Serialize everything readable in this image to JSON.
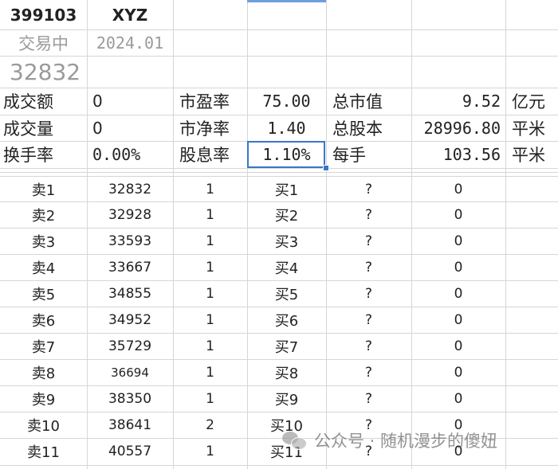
{
  "header": {
    "code": "399103",
    "name": "XYZ",
    "status": "交易中",
    "date": "2024.01",
    "price": "32832"
  },
  "stats": [
    {
      "label": "成交额",
      "value": "0",
      "label2": "市盈率",
      "value2": "75.00",
      "label3": "总市值",
      "value3": "9.52",
      "unit": "亿元"
    },
    {
      "label": "成交量",
      "value": "0",
      "label2": "市净率",
      "value2": "1.40",
      "label3": "总股本",
      "value3": "28996.80",
      "unit": "平米"
    },
    {
      "label": "换手率",
      "value": "0.00%",
      "label2": "股息率",
      "value2": "1.10%",
      "label3": "每手",
      "value3": "103.56",
      "unit": "平米"
    }
  ],
  "orderbook": [
    {
      "sell": "卖1",
      "price": "32832",
      "qty": "1",
      "buy": "买1",
      "bprice": "?",
      "bqty": "0"
    },
    {
      "sell": "卖2",
      "price": "32928",
      "qty": "1",
      "buy": "买2",
      "bprice": "?",
      "bqty": "0"
    },
    {
      "sell": "卖3",
      "price": "33593",
      "qty": "1",
      "buy": "买3",
      "bprice": "?",
      "bqty": "0"
    },
    {
      "sell": "卖4",
      "price": "33667",
      "qty": "1",
      "buy": "买4",
      "bprice": "?",
      "bqty": "0"
    },
    {
      "sell": "卖5",
      "price": "34855",
      "qty": "1",
      "buy": "买5",
      "bprice": "?",
      "bqty": "0"
    },
    {
      "sell": "卖6",
      "price": "34952",
      "qty": "1",
      "buy": "买6",
      "bprice": "?",
      "bqty": "0"
    },
    {
      "sell": "卖7",
      "price": "35729",
      "qty": "1",
      "buy": "买7",
      "bprice": "?",
      "bqty": "0"
    },
    {
      "sell": "卖8",
      "price": "36694",
      "qty": "1",
      "buy": "买8",
      "bprice": "?",
      "bqty": "0"
    },
    {
      "sell": "卖9",
      "price": "38350",
      "qty": "1",
      "buy": "买9",
      "bprice": "?",
      "bqty": "0"
    },
    {
      "sell": "卖10",
      "price": "38641",
      "qty": "2",
      "buy": "买10",
      "bprice": "?",
      "bqty": "0"
    },
    {
      "sell": "卖11",
      "price": "40557",
      "qty": "1",
      "buy": "买11",
      "bprice": "?",
      "bqty": "0"
    }
  ],
  "watermark": "公众号 · 随机漫步的傻妞",
  "colors": {
    "selection": "#3b76c9",
    "gridline": "#d6d6d6"
  }
}
